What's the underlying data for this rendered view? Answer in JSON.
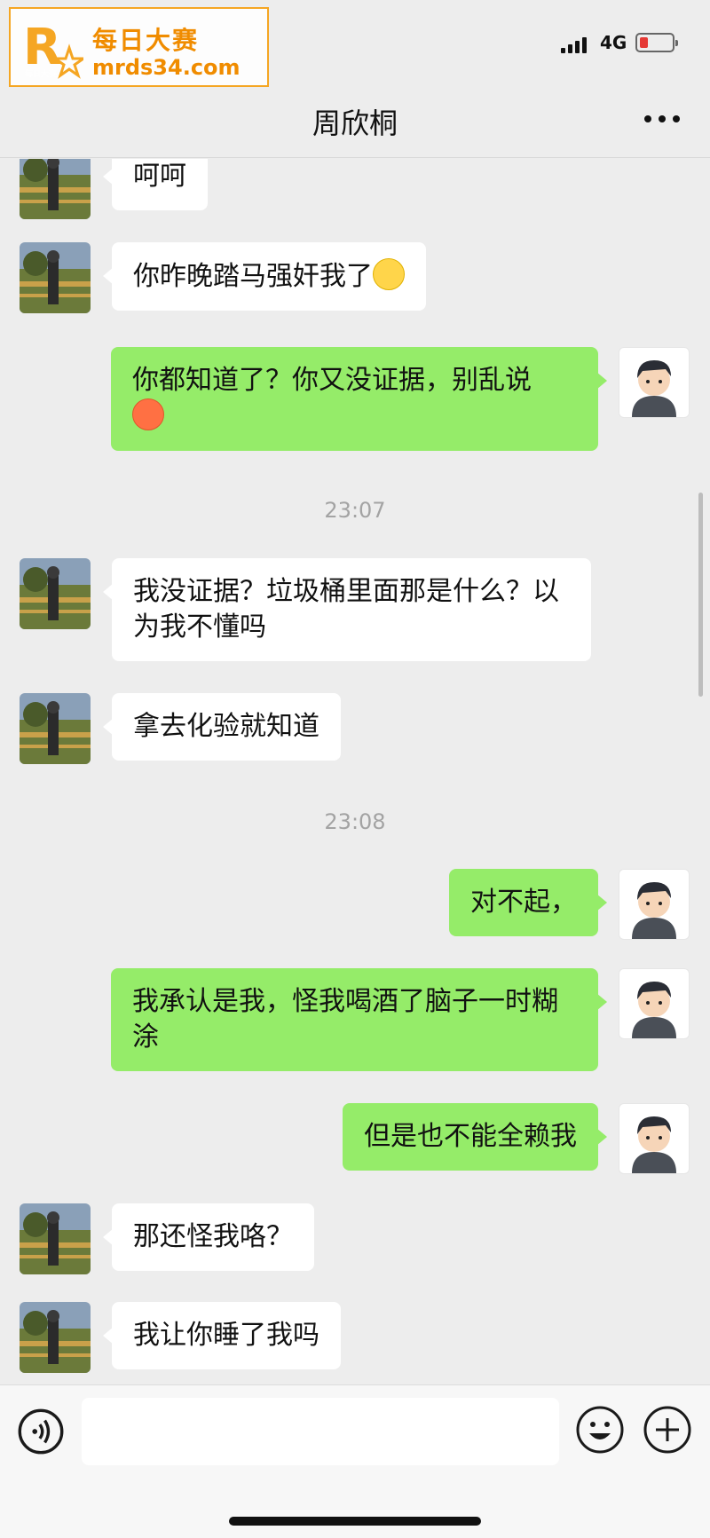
{
  "watermark": {
    "logo_text": "每日大赛",
    "name": "每日大赛",
    "url": "mrds34.com"
  },
  "status_bar": {
    "network": "4G"
  },
  "header": {
    "title": "周欣桐"
  },
  "messages": [
    {
      "side": "left",
      "text": "呵呵"
    },
    {
      "side": "left",
      "text": "你昨晚踏马强奸我了"
    },
    {
      "side": "right",
      "text": "你都知道了？你又没证据，别乱说"
    },
    {
      "side": "left",
      "text": "我没证据？垃圾桶里面那是什么？以为我不懂吗"
    },
    {
      "side": "left",
      "text": "拿去化验就知道"
    },
    {
      "side": "right",
      "text": "对不起，"
    },
    {
      "side": "right",
      "text": "我承认是我，怪我喝酒了脑子一时糊涂"
    },
    {
      "side": "right",
      "text": "但是也不能全赖我"
    },
    {
      "side": "left",
      "text": "那还怪我咯？"
    },
    {
      "side": "left",
      "text": "我让你睡了我吗"
    }
  ],
  "timestamps": [
    "23:07",
    "23:08"
  ],
  "icons": {
    "signal": "signal-icon",
    "battery": "battery-icon",
    "more": "more-icon",
    "voice": "voice-icon",
    "emoji": "emoji-icon",
    "plus": "plus-icon",
    "smile_emoji": "smile-emoji",
    "sweat_emoji": "sweat-emoji"
  },
  "colors": {
    "self_bubble": "#95ec69",
    "other_bubble": "#ffffff",
    "background": "#ededed",
    "watermark": "#f08c00",
    "battery_low": "#e53935"
  }
}
